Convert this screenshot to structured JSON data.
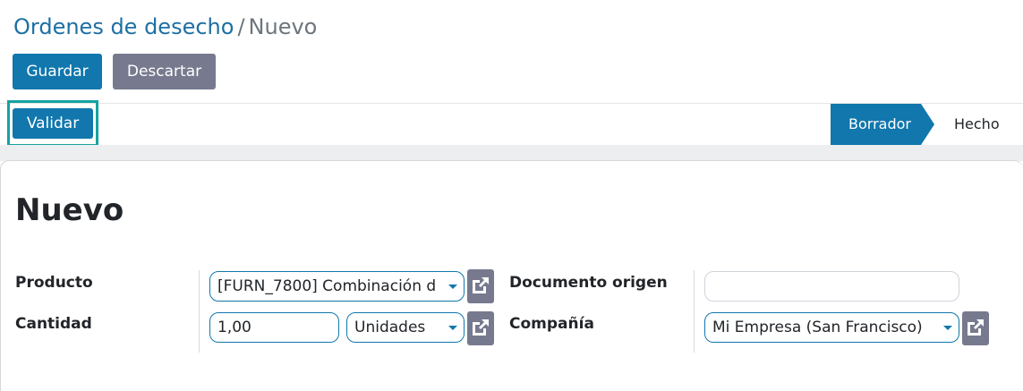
{
  "breadcrumb": {
    "parent": "Ordenes de desecho",
    "separator": "/",
    "current": "Nuevo"
  },
  "actions": {
    "save_label": "Guardar",
    "discard_label": "Descartar"
  },
  "statusbar": {
    "validate_label": "Validar",
    "stages": [
      "Borrador",
      "Hecho"
    ],
    "active_stage": "Borrador"
  },
  "form": {
    "title": "Nuevo",
    "fields": {
      "product": {
        "label": "Producto",
        "value": "[FURN_7800] Combinación d"
      },
      "quantity": {
        "label": "Cantidad",
        "value": "1,00",
        "uom": "Unidades"
      },
      "origin": {
        "label": "Documento origen",
        "value": ""
      },
      "company": {
        "label": "Compañía",
        "value": "Mi Empresa (San Francisco)"
      }
    }
  },
  "colors": {
    "primary": "#1177ad",
    "secondary": "#777a8e",
    "highlight": "#14a3a0"
  },
  "icons": {
    "external_link": "external-link-icon",
    "dropdown": "chevron-down-icon"
  }
}
